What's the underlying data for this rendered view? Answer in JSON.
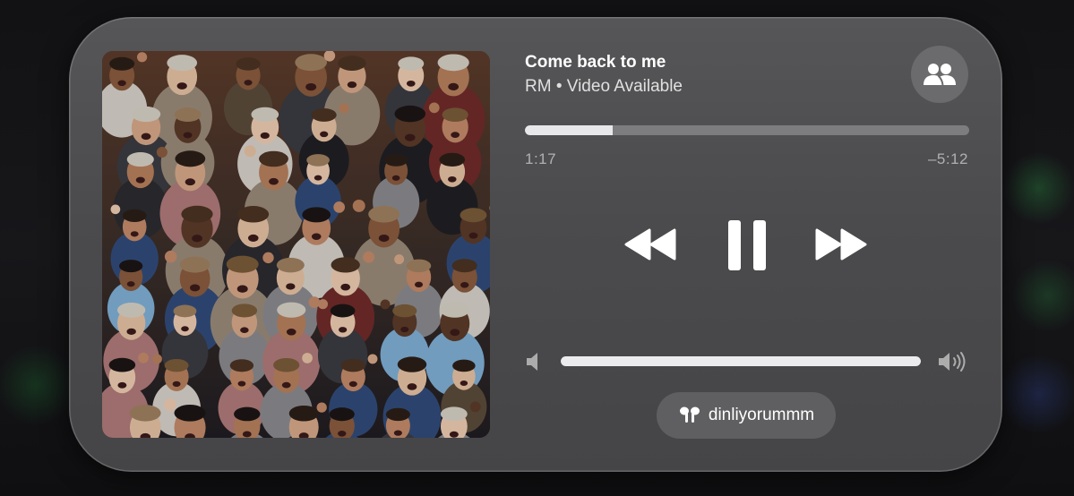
{
  "now_playing": {
    "title": "Come back to me",
    "subtitle": "RM • Video Available",
    "artwork_icon": "album-artwork-crowd-photo"
  },
  "progress": {
    "elapsed": "1:17",
    "remaining": "–5:12",
    "fraction": 0.198
  },
  "controls": {
    "share_icon": "shareplay-people-icon",
    "rewind_icon": "rewind-icon",
    "pause_icon": "pause-icon",
    "forward_icon": "fast-forward-icon"
  },
  "volume": {
    "level": 1.0,
    "low_icon": "speaker-low-icon",
    "high_icon": "speaker-high-icon"
  },
  "output_device": {
    "name": "dinliyorummm",
    "icon": "airpods-icon"
  },
  "colors": {
    "card_bg": "#4e4e50",
    "progress_fill": "#e8e8ea",
    "track": "#7d7d80",
    "text_primary": "#ffffff"
  }
}
